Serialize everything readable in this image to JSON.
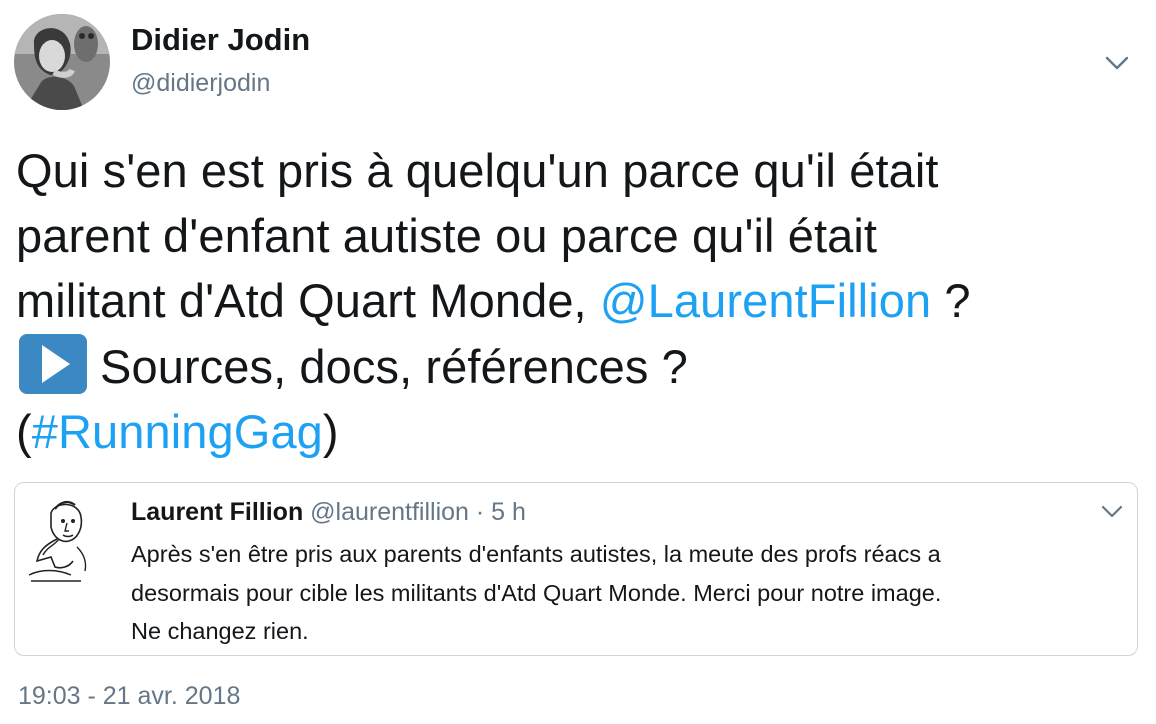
{
  "tweet": {
    "author_name": "Didier Jodin",
    "author_handle": "@didierjodin",
    "text_lines": [
      "Qui s'en est pris à quelqu'un parce qu'il était",
      "parent d'enfant autiste ou parce qu'il était",
      "militant d'Atd Quart Monde, "
    ],
    "mention": "@LaurentFillion",
    "mention_suffix": " ?",
    "emoji_icon": "play-button-emoji",
    "emoji_line_text": "Sources, docs, références ?",
    "hashtag_prefix": "(",
    "hashtag": "#RunningGag",
    "hashtag_suffix": ")",
    "timestamp": "19:03 - 21 avr. 2018"
  },
  "quoted_tweet": {
    "author_name": "Laurent Fillion",
    "meta": "@laurentfillion · 5 h",
    "text_lines": [
      "Après s'en être pris aux parents d'enfants autistes, la meute des profs réacs a",
      "desormais pour cible les militants d'Atd Quart Monde. Merci pour notre image.",
      "Ne changez rien."
    ]
  },
  "colors": {
    "link": "#1da1f2",
    "text": "#14171a",
    "secondary": "#657786",
    "border": "#ccd6dd",
    "emoji_blue": "#3b88c3"
  }
}
